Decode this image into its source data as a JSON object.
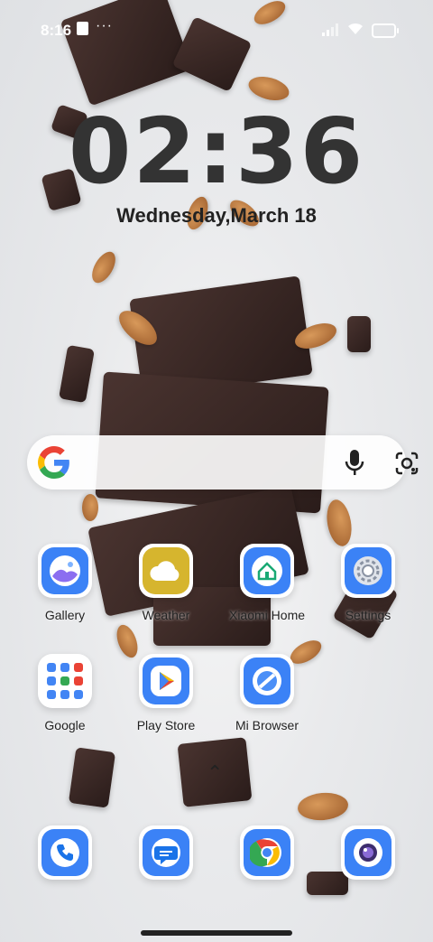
{
  "status_bar": {
    "time": "8:16",
    "dots": "···"
  },
  "lock": {
    "clock": "02:36",
    "date": "Wednesday,March 18"
  },
  "home": {
    "row1": [
      {
        "label": "Gallery",
        "icon": "gallery-icon"
      },
      {
        "label": "Weather",
        "icon": "weather-icon"
      },
      {
        "label": "Xiaomi Home",
        "icon": "xiaomi-home-icon"
      },
      {
        "label": "Settings",
        "icon": "settings-icon"
      }
    ],
    "row2": [
      {
        "label": "Google",
        "icon": "google-folder-icon"
      },
      {
        "label": "Play Store",
        "icon": "play-store-icon"
      },
      {
        "label": "Mi Browser",
        "icon": "mi-browser-icon"
      }
    ],
    "up_arrow": "⌃"
  },
  "dock": [
    {
      "icon": "phone-icon"
    },
    {
      "icon": "messages-icon"
    },
    {
      "icon": "chrome-icon"
    },
    {
      "icon": "camera-icon"
    }
  ],
  "colors": {
    "accent_blue": "#3b82f6",
    "weather_yellow": "#d6b52e"
  }
}
